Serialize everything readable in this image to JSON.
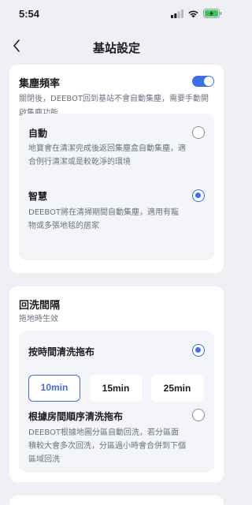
{
  "status": {
    "time": "5:54"
  },
  "nav": {
    "title": "基站設定"
  },
  "dust": {
    "title": "集塵頻率",
    "desc": "關閉後，DEEBOT回到基站不會自動集塵，需要手動開啟集塵功能",
    "toggle_on": true,
    "options": [
      {
        "title": "自動",
        "desc": "地寶會在清潔完成後返回集塵盒自動集塵，適合例行清潔或是較乾淨的環境",
        "selected": false
      },
      {
        "title": "智慧",
        "desc": "DEEBOT將在清掃期間自動集塵，適用有寵物或多張地毯的居家",
        "selected": true
      }
    ]
  },
  "wash": {
    "title": "回洗間隔",
    "subtitle": "拖地時生效",
    "options": [
      {
        "title": "按時間清洗拖布",
        "selected": true
      },
      {
        "title": "根據房間順序清洗拖布",
        "desc": "DEEBOT根據地圖分區自動回洗，若分區面積較大會多次回洗，分區過小時會合併到下個區域回洗",
        "selected": false
      }
    ],
    "intervals": [
      "10min",
      "15min",
      "25min"
    ],
    "selected_interval": "10min"
  },
  "colors": {
    "accent": "#3d6ef0",
    "background": "#eef0f4"
  }
}
